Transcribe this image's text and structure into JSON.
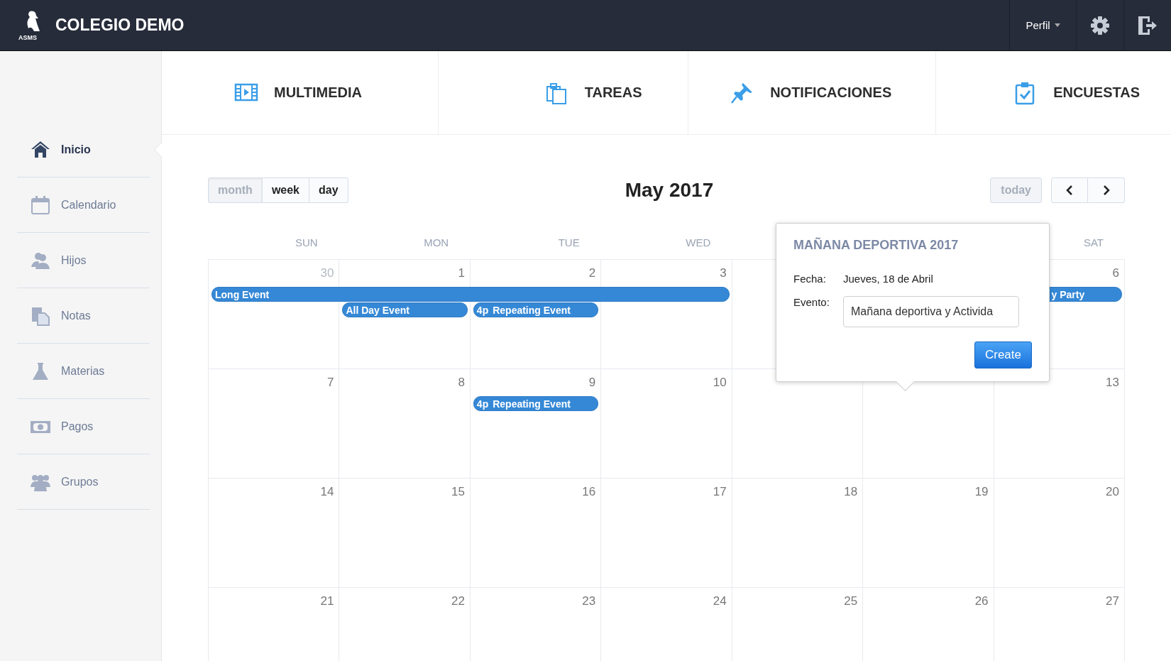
{
  "header": {
    "logo_text": "ASMS",
    "title": "COLEGIO DEMO",
    "profile_menu": "Perfil"
  },
  "sidebar": {
    "items": [
      {
        "label": "Inicio",
        "selected": true
      },
      {
        "label": "Calendario",
        "selected": false
      },
      {
        "label": "Hijos",
        "selected": false
      },
      {
        "label": "Notas",
        "selected": false
      },
      {
        "label": "Materias",
        "selected": false
      },
      {
        "label": "Pagos",
        "selected": false
      },
      {
        "label": "Grupos",
        "selected": false
      }
    ]
  },
  "tabs": [
    {
      "label": "MULTIMEDIA"
    },
    {
      "label": "TAREAS"
    },
    {
      "label": "NOTIFICACIONES"
    },
    {
      "label": "ENCUESTAS"
    }
  ],
  "calendar": {
    "views": [
      {
        "label": "month",
        "selected": true
      },
      {
        "label": "week",
        "selected": false
      },
      {
        "label": "day",
        "selected": false
      }
    ],
    "title": "May 2017",
    "today_button": "today",
    "today_disabled": true,
    "weekdays": [
      "SUN",
      "MON",
      "TUE",
      "WED",
      "SAT"
    ],
    "weeks": [
      {
        "days": [
          {
            "number": "30",
            "other_month": true
          },
          {
            "number": "1",
            "other_month": false
          },
          {
            "number": "2",
            "other_month": false
          },
          {
            "number": "3",
            "other_month": false
          },
          {
            "number": "6",
            "other_month": false
          }
        ],
        "events": [
          {
            "title": "Long Event",
            "cut_left": false
          },
          {
            "title": "y Party",
            "cut_left": true
          },
          {
            "title": "All Day Event",
            "cut_left": false
          },
          {
            "title": "Repeating Event",
            "time": "4p",
            "cut_left": false
          }
        ]
      },
      {
        "days": [
          {
            "number": "7",
            "other_month": false
          },
          {
            "number": "8",
            "other_month": false
          },
          {
            "number": "9",
            "other_month": false
          },
          {
            "number": "10",
            "other_month": false
          },
          {
            "number": "13",
            "other_month": false
          }
        ],
        "events": [
          {
            "title": "Repeating Event",
            "time": "4p",
            "cut_left": false
          }
        ]
      },
      {
        "days": [
          {
            "number": "14",
            "other_month": false
          },
          {
            "number": "15",
            "other_month": false
          },
          {
            "number": "16",
            "other_month": false
          },
          {
            "number": "17",
            "other_month": false
          },
          {
            "number": "18",
            "other_month": false
          },
          {
            "number": "19",
            "other_month": false
          },
          {
            "number": "20",
            "other_month": false
          }
        ]
      },
      {
        "days": [
          {
            "number": "21",
            "other_month": false
          },
          {
            "number": "22",
            "other_month": false
          },
          {
            "number": "23",
            "other_month": false
          },
          {
            "number": "24",
            "other_month": false
          },
          {
            "number": "25",
            "other_month": false
          },
          {
            "number": "26",
            "other_month": false
          },
          {
            "number": "27",
            "other_month": false
          }
        ]
      }
    ]
  },
  "popup": {
    "title": "MAÑANA DEPORTIVA 2017",
    "date_label": "Fecha:",
    "date_value": "Jueves, 18 de Abril",
    "event_label": "Evento:",
    "event_value": "Mañana deportiva y Activida",
    "button": "Create"
  }
}
